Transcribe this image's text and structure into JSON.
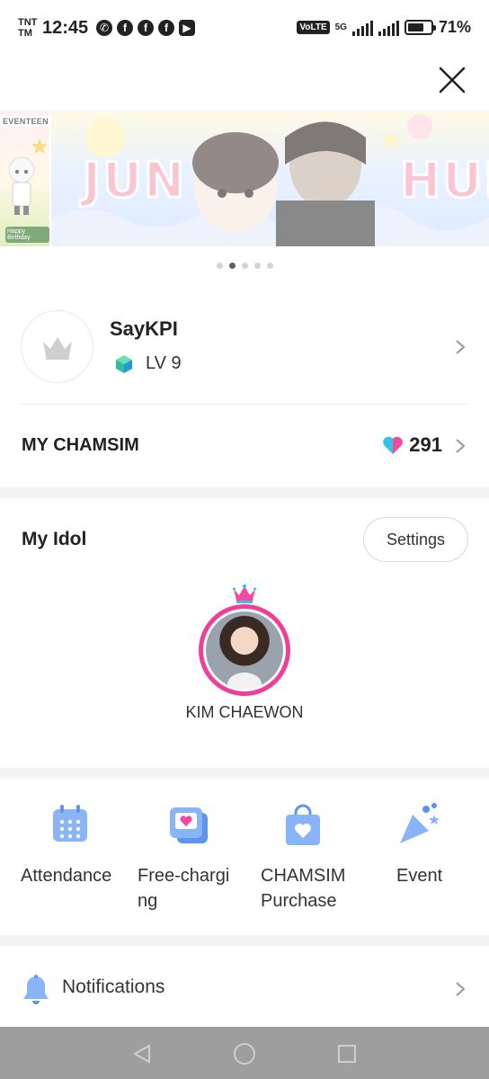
{
  "status_bar": {
    "carrier_line1": "TNT",
    "carrier_line2": "TM",
    "time": "12:45",
    "network_badge": "VoLTE",
    "network_type": "5G",
    "battery_percent": "71%",
    "battery_level": 0.71,
    "app_icons": [
      "whatsapp-icon",
      "facebook-icon",
      "facebook-icon",
      "facebook-icon",
      "video-icon"
    ]
  },
  "banner": {
    "left_tag": "EVENTEEN",
    "left_caption": "Happy Birthday",
    "word_left": "JUN",
    "word_right": "HUI",
    "slide_count": 5,
    "active_index": 1
  },
  "profile": {
    "username": "SayKPI",
    "level": "LV 9"
  },
  "chamsim": {
    "label": "MY CHAMSIM",
    "count": "291"
  },
  "my_idol": {
    "title": "My Idol",
    "settings_label": "Settings",
    "idol_name": "KIM CHAEWON"
  },
  "shortcuts": [
    {
      "label": "Attendance",
      "icon": "calendar-icon"
    },
    {
      "label": "Free-charging",
      "icon": "wallet-heart-icon"
    },
    {
      "label": "CHAMSIM Purchase",
      "icon": "shopping-bag-icon"
    },
    {
      "label": "Event",
      "icon": "party-popper-icon"
    }
  ],
  "notifications": {
    "label": "Notifications"
  },
  "colors": {
    "accent_pink": "#ef3f9a",
    "icon_blue": "#8ab4f8",
    "divider": "#f4f4f5"
  }
}
